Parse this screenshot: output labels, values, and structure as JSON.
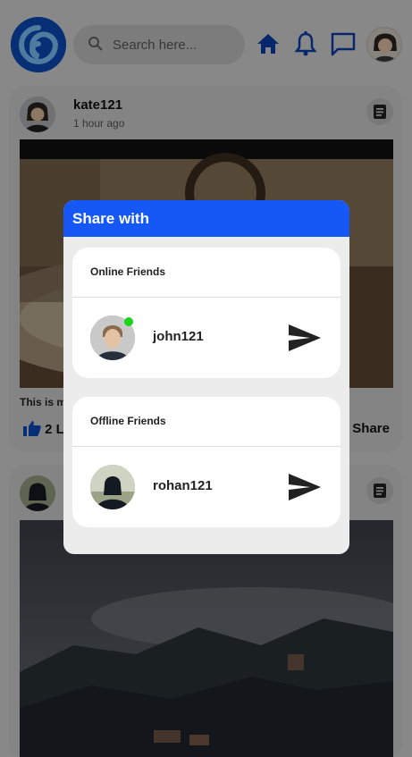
{
  "header": {
    "search_placeholder": "Search here..."
  },
  "icons": {
    "logo": "logo-wave-icon",
    "search": "search-icon",
    "home": "home-icon",
    "notifications": "bell-icon",
    "messages": "chat-icon",
    "post_menu": "note-icon",
    "like": "thumbs-up-icon",
    "send": "send-icon"
  },
  "posts": [
    {
      "username": "kate121",
      "time": "1 hour ago",
      "caption_visible": "This is m",
      "likes_visible": "2 L",
      "share_label": "Share"
    },
    {
      "username": "",
      "time": ""
    }
  ],
  "modal": {
    "title": "Share with",
    "online": {
      "heading": "Online Friends",
      "friends": [
        {
          "name": "john121",
          "status": "online"
        }
      ]
    },
    "offline": {
      "heading": "Offline Friends",
      "friends": [
        {
          "name": "rohan121",
          "status": "offline"
        }
      ]
    }
  },
  "colors": {
    "brand_blue": "#1558f5",
    "nav_blue": "#0b3fae",
    "online_green": "#19d419"
  }
}
